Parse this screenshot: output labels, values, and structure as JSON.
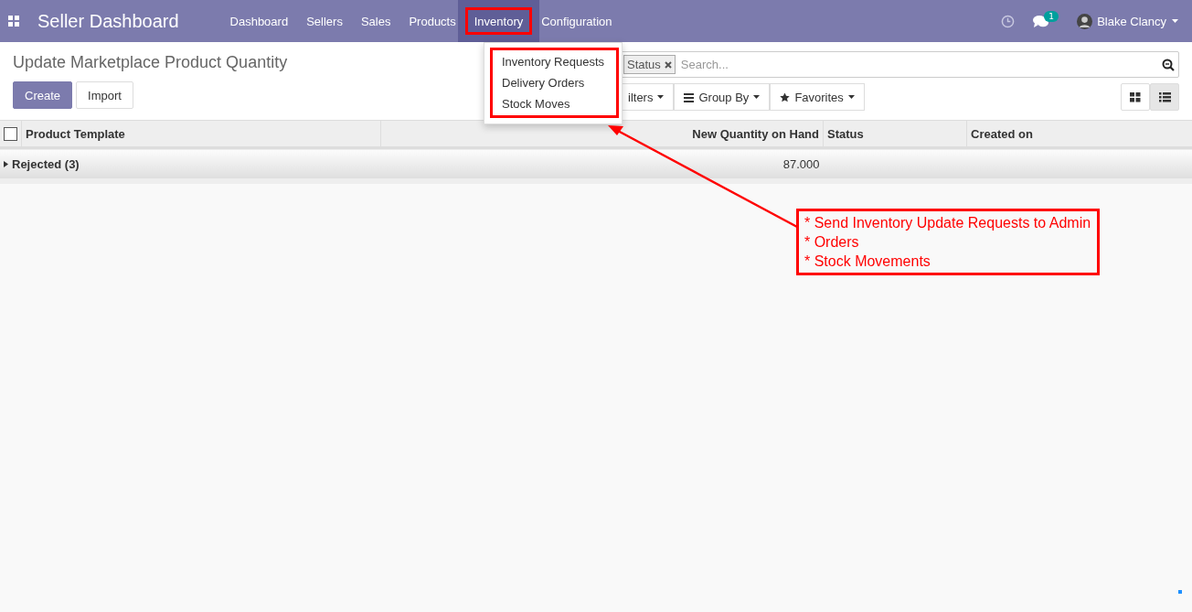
{
  "app_title": "Seller Dashboard",
  "nav": [
    {
      "label": "Dashboard",
      "selected": false
    },
    {
      "label": "Sellers",
      "selected": false
    },
    {
      "label": "Sales",
      "selected": false
    },
    {
      "label": "Products",
      "selected": false
    },
    {
      "label": "Inventory",
      "selected": true
    },
    {
      "label": "Configuration",
      "selected": false
    }
  ],
  "messages_badge": "1",
  "user": "Blake Clancy",
  "dropdown": [
    "Inventory Requests",
    "Delivery Orders",
    "Stock Moves"
  ],
  "page_title": "Update Marketplace Product Quantity",
  "buttons": [
    "Create",
    "Import"
  ],
  "search": {
    "facet": "Status",
    "placeholder": "Search..."
  },
  "filters": [
    "ilters",
    "Group By",
    "Favorites"
  ],
  "views": [
    {
      "kind": "kanban",
      "selected": false
    },
    {
      "kind": "list",
      "selected": true
    }
  ],
  "table": {
    "select_all": {
      "checked": false
    },
    "columns": [
      "Product Template",
      "New Quantity on Hand",
      "Status",
      "Created on"
    ],
    "groups": [
      {
        "label": "Rejected (3)",
        "quantity": "87.000"
      }
    ]
  },
  "annotation": [
    "* Send Inventory Update Requests to Admin",
    "* Orders",
    "* Stock Movements"
  ]
}
